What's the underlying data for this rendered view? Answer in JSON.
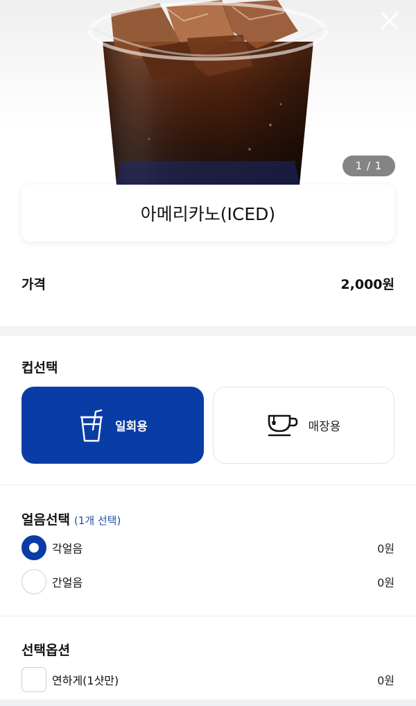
{
  "hero": {
    "pager": "1 / 1",
    "close_icon": "close-icon",
    "image": "iced-americano-cup"
  },
  "product": {
    "name": "아메리카노(ICED)",
    "price_label": "가격",
    "price_value": "2,000원"
  },
  "cup_section": {
    "title": "컵선택",
    "options": [
      {
        "label": "일회용",
        "icon": "disposable-cup-icon",
        "selected": true
      },
      {
        "label": "매장용",
        "icon": "mug-icon",
        "selected": false
      }
    ]
  },
  "ice_section": {
    "title": "얼음선택",
    "note": "(1개 선택)",
    "options": [
      {
        "label": "각얼음",
        "price": "0원",
        "selected": true
      },
      {
        "label": "간얼음",
        "price": "0원",
        "selected": false
      }
    ]
  },
  "extra_section": {
    "title": "선택옵션",
    "options": [
      {
        "label": "연하게(1샷만)",
        "price": "0원",
        "checked": false
      }
    ]
  },
  "colors": {
    "accent": "#0a3ca6",
    "note": "#1f4fa8"
  }
}
